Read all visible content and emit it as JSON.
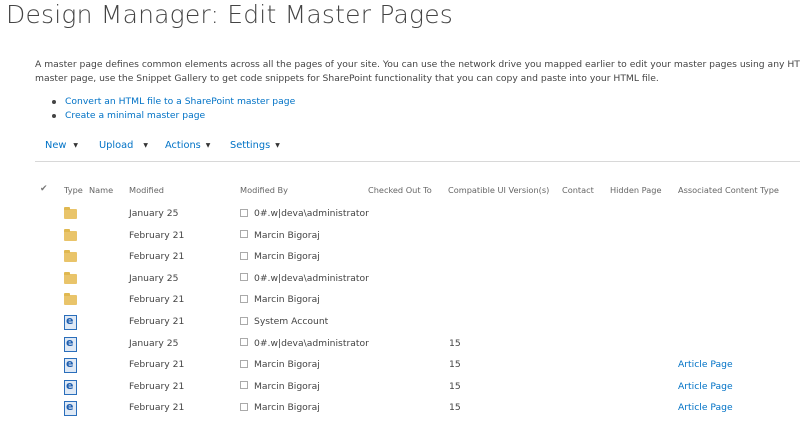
{
  "page": {
    "title": "Design Manager: Edit Master Pages",
    "description_line1": "A master page defines common elements across all the pages of your site. You can use the network drive you mapped earlier to edit your master pages using any HTML",
    "description_line2": "master page, use the Snippet Gallery to get code snippets for SharePoint functionality that you can copy and paste into your HTML file."
  },
  "links": [
    {
      "label": "Convert an HTML file to a SharePoint master page"
    },
    {
      "label": "Create a minimal master page"
    }
  ],
  "toolbar": {
    "new_label": "New",
    "upload_label": "Upload",
    "actions_label": "Actions",
    "settings_label": "Settings"
  },
  "columns": {
    "type": "Type",
    "name": "Name",
    "modified": "Modified",
    "modified_by": "Modified By",
    "checked_out_to": "Checked Out To",
    "compatible_ui": "Compatible UI Version(s)",
    "contact": "Contact",
    "hidden_page": "Hidden Page",
    "assoc_content_type": "Associated Content Type"
  },
  "rows": [
    {
      "type": "folder",
      "modified": "January 25",
      "modified_by": "0#.w|deva\\administrator",
      "compat": "",
      "content_type": ""
    },
    {
      "type": "folder",
      "modified": "February 21",
      "modified_by": "Marcin Bigoraj",
      "compat": "",
      "content_type": ""
    },
    {
      "type": "folder",
      "modified": "February 21",
      "modified_by": "Marcin Bigoraj",
      "compat": "",
      "content_type": ""
    },
    {
      "type": "folder",
      "modified": "January 25",
      "modified_by": "0#.w|deva\\administrator",
      "compat": "",
      "content_type": ""
    },
    {
      "type": "folder",
      "modified": "February 21",
      "modified_by": "Marcin Bigoraj",
      "compat": "",
      "content_type": ""
    },
    {
      "type": "ie-file",
      "modified": "February 21",
      "modified_by": "System Account",
      "compat": "",
      "content_type": ""
    },
    {
      "type": "ie-file",
      "modified": "January 25",
      "modified_by": "0#.w|deva\\administrator",
      "compat": "15",
      "content_type": ""
    },
    {
      "type": "ie-file",
      "modified": "February 21",
      "modified_by": "Marcin Bigoraj",
      "compat": "15",
      "content_type": "Article Page"
    },
    {
      "type": "ie-file",
      "modified": "February 21",
      "modified_by": "Marcin Bigoraj",
      "compat": "15",
      "content_type": "Article Page"
    },
    {
      "type": "ie-file",
      "modified": "February 21",
      "modified_by": "Marcin Bigoraj",
      "compat": "15",
      "content_type": "Article Page"
    }
  ]
}
